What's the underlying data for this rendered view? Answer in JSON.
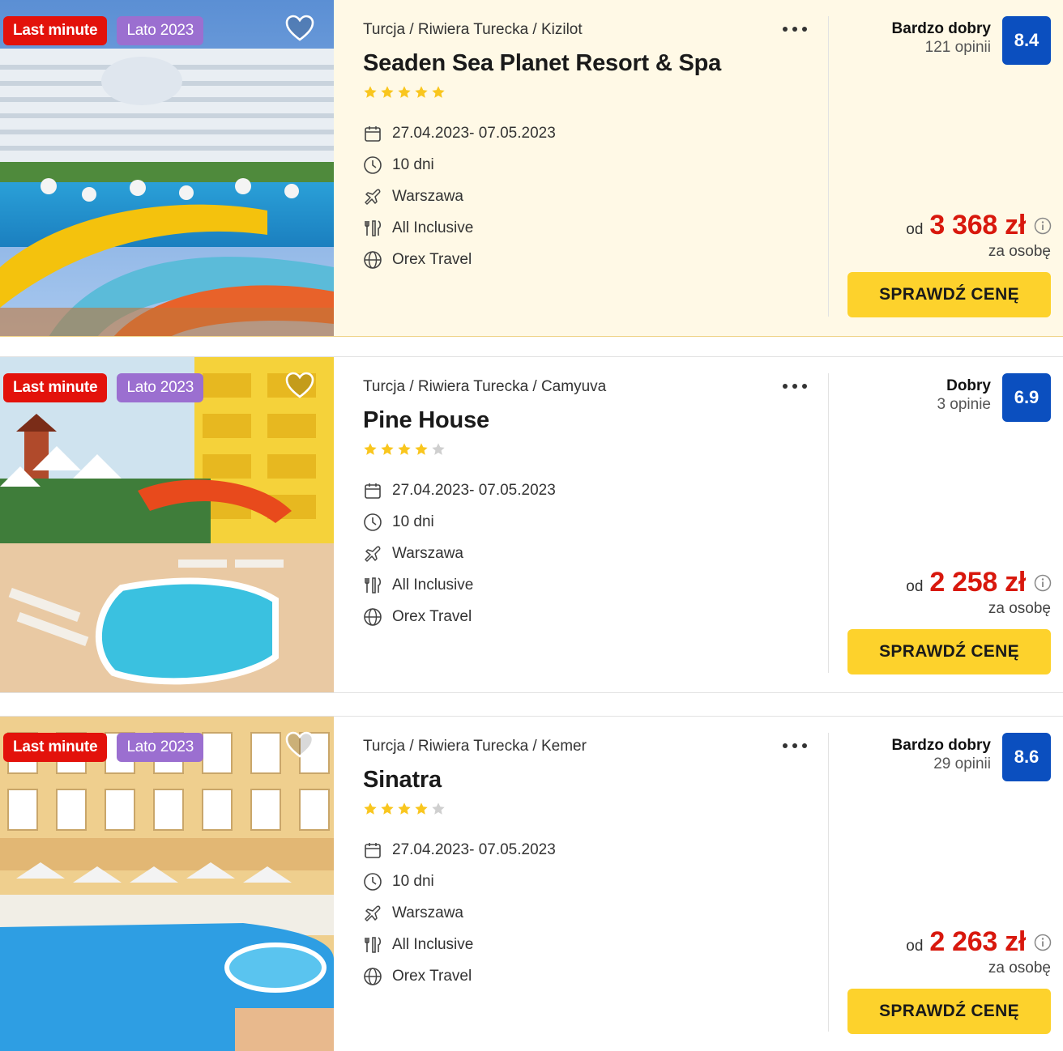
{
  "colors": {
    "last_minute_badge": "#e3120b",
    "season_badge": "#9b6fd0",
    "score_badge": "#0b4fbf",
    "price": "#d8180d",
    "cta": "#fdd22c",
    "star_filled": "#f9c61e",
    "star_empty": "#cfcfcf",
    "highlight_card_bg": "#fff9e6"
  },
  "offers": [
    {
      "badges": {
        "last_minute": "Last minute",
        "season": "Lato 2023"
      },
      "breadcrumb": "Turcja / Riwiera Turecka / Kizilot",
      "name": "Seaden Sea Planet Resort & Spa",
      "stars": 5,
      "max_stars": 5,
      "dates": "27.04.2023- 07.05.2023",
      "duration": "10 dni",
      "departure": "Warszawa",
      "board": "All Inclusive",
      "operator": "Orex Travel",
      "rating_label": "Bardzo dobry",
      "reviews": "121 opinii",
      "score": "8.4",
      "price_prefix": "od",
      "price": "3 368 zł",
      "price_note": "za osobę",
      "cta": "SPRAWDŹ CENĘ",
      "favorite_icon": "heart-outline-icon",
      "highlighted": true
    },
    {
      "badges": {
        "last_minute": "Last minute",
        "season": "Lato 2023"
      },
      "breadcrumb": "Turcja / Riwiera Turecka / Camyuva",
      "name": "Pine House",
      "stars": 4,
      "max_stars": 5,
      "dates": "27.04.2023- 07.05.2023",
      "duration": "10 dni",
      "departure": "Warszawa",
      "board": "All Inclusive",
      "operator": "Orex Travel",
      "rating_label": "Dobry",
      "reviews": "3 opinie",
      "score": "6.9",
      "price_prefix": "od",
      "price": "2 258 zł",
      "price_note": "za osobę",
      "cta": "SPRAWDŹ CENĘ",
      "favorite_icon": "heart-outline-icon",
      "highlighted": false
    },
    {
      "badges": {
        "last_minute": "Last minute",
        "season": "Lato 2023"
      },
      "breadcrumb": "Turcja / Riwiera Turecka / Kemer",
      "name": "Sinatra",
      "stars": 4,
      "max_stars": 5,
      "dates": "27.04.2023- 07.05.2023",
      "duration": "10 dni",
      "departure": "Warszawa",
      "board": "All Inclusive",
      "operator": "Orex Travel",
      "rating_label": "Bardzo dobry",
      "reviews": "29 opinii",
      "score": "8.6",
      "price_prefix": "od",
      "price": "2 263 zł",
      "price_note": "za osobę",
      "cta": "SPRAWDŹ CENĘ",
      "favorite_icon": "heart-outline-icon",
      "highlighted": false
    }
  ]
}
